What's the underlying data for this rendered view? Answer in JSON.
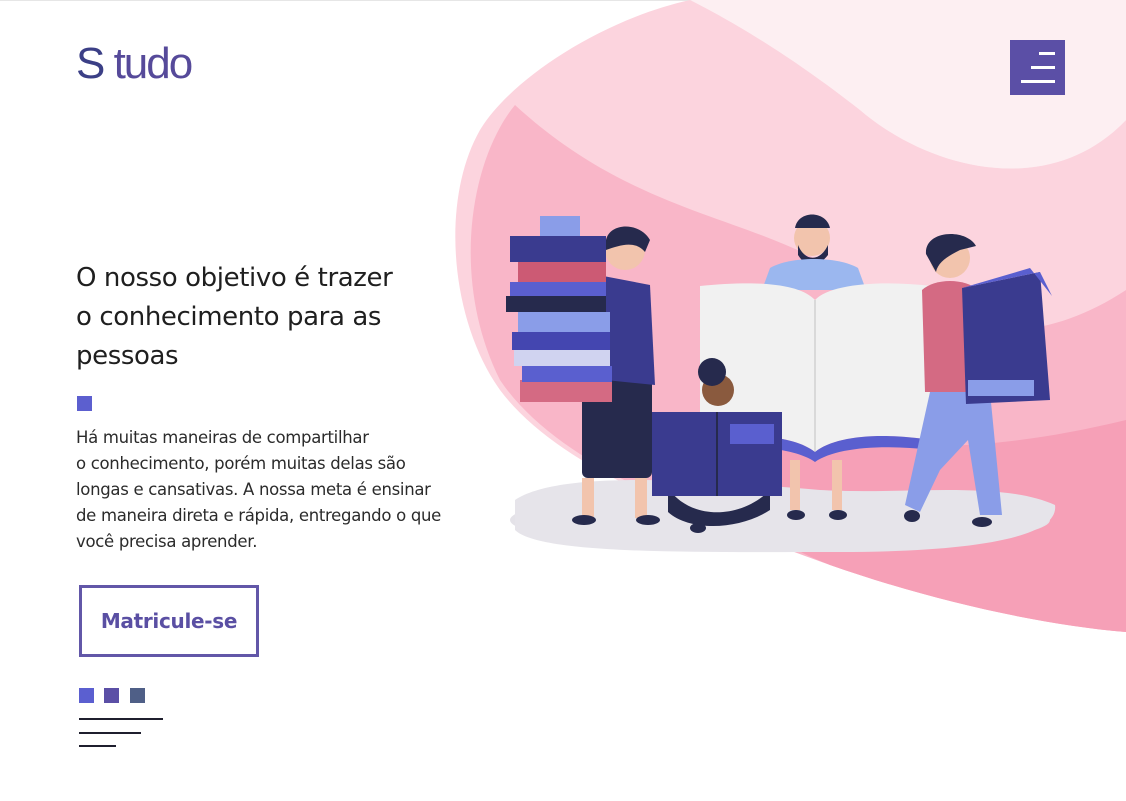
{
  "brand": {
    "logo_s": "S",
    "logo_rest": " tudo"
  },
  "header": {
    "menu_icon": "menu-icon"
  },
  "hero": {
    "headline_line1": "O nosso objetivo é trazer",
    "headline_line2": "o conhecimento para as",
    "headline_line3": "pessoas",
    "description": "Há muitas maneiras de compartilhar\no conhecimento, porém muitas delas são\nlongas e cansativas. A nossa meta é ensinar\nde maneira direta e rápida, entregando o que\nvocê precisa aprender.",
    "cta_label": "Matricule-se",
    "illustration": "people-with-books-illustration"
  },
  "colors": {
    "brand": "#5b4fa6",
    "accent": "#5c5fcf",
    "dot1": "#5b5fd0",
    "dot2": "#5b4fa6",
    "dot3": "#4f5f87",
    "blob_light": "#fde6ec",
    "blob_mid": "#fbc8d5",
    "blob_dark": "#f7a3ba"
  }
}
